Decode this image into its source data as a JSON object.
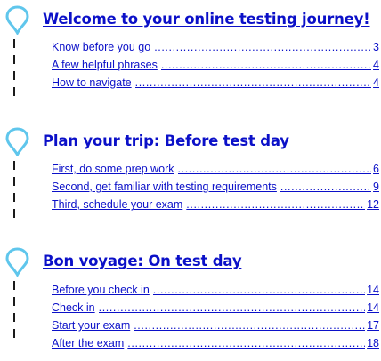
{
  "colors": {
    "link": "#0b10c8",
    "pin": "#5fc6ec",
    "dashes": "#1a1a1a"
  },
  "icons": {
    "pin": "map-pin-icon"
  },
  "sections": [
    {
      "title": "Welcome to your online testing journey!",
      "items": [
        {
          "label": "Know before you go",
          "page": "3"
        },
        {
          "label": "A few helpful phrases",
          "page": "4"
        },
        {
          "label": "How to navigate",
          "page": "4"
        }
      ]
    },
    {
      "title": "Plan your trip: Before test day",
      "items": [
        {
          "label": "First, do some prep work",
          "page": "6"
        },
        {
          "label": "Second, get familiar with testing requirements",
          "page": "9"
        },
        {
          "label": "Third, schedule your exam",
          "page": "12"
        }
      ]
    },
    {
      "title": "Bon voyage: On test day",
      "items": [
        {
          "label": "Before you check in",
          "page": "14"
        },
        {
          "label": "Check in",
          "page": "14"
        },
        {
          "label": "Start your exam",
          "page": "17"
        },
        {
          "label": "After the exam",
          "page": "18"
        }
      ]
    }
  ]
}
